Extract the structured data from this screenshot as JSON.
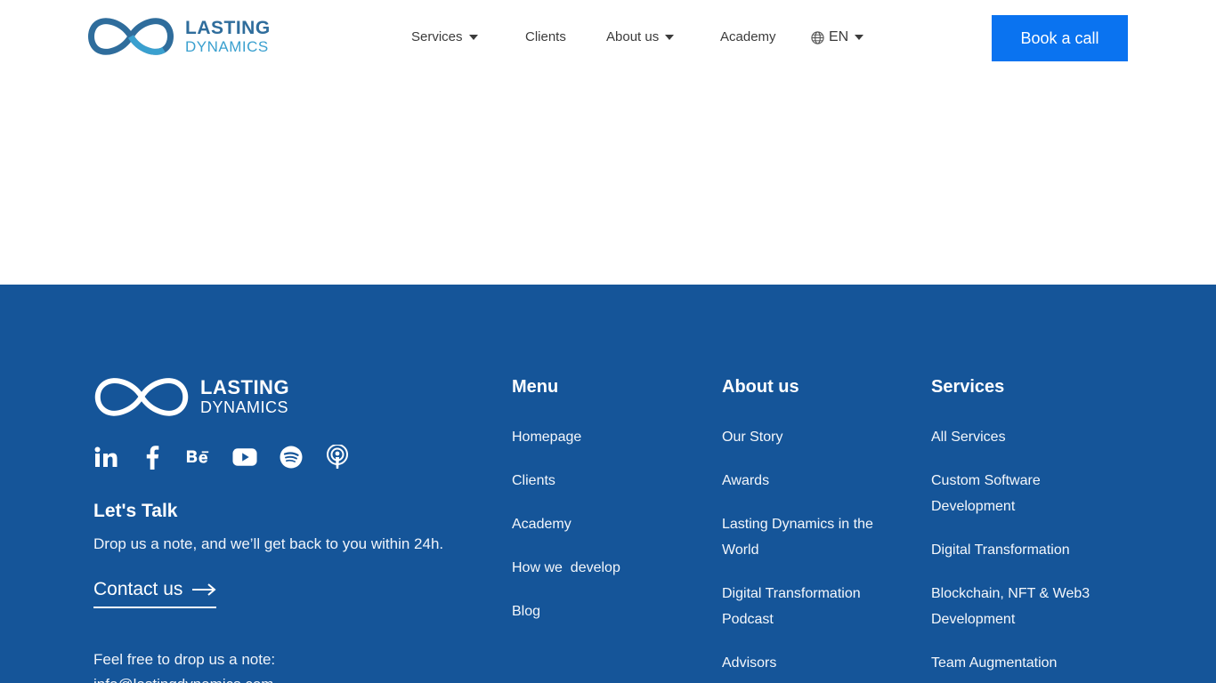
{
  "header": {
    "logo": {
      "line1": "LASTING",
      "line2": "DYNAMICS"
    },
    "nav": [
      {
        "label": "Services",
        "dropdown": true
      },
      {
        "label": "Clients",
        "dropdown": false
      },
      {
        "label": "About us",
        "dropdown": true
      },
      {
        "label": "Academy",
        "dropdown": false
      }
    ],
    "language": {
      "label": "EN",
      "icon": "globe-icon"
    },
    "cta_label": "Book a call",
    "cta_color": "#0a73f0"
  },
  "footer": {
    "bg_color": "#155599",
    "logo": {
      "line1": "LASTING",
      "line2": "DYNAMICS"
    },
    "socials": [
      "linkedin-icon",
      "facebook-icon",
      "behance-icon",
      "youtube-icon",
      "spotify-icon",
      "podcast-icon"
    ],
    "talk_title": "Let's Talk",
    "talk_sub": "Drop us a note, and we’ll get back to you within 24h.",
    "contact_label": "Contact us",
    "note_label": "Feel free to drop us a note:",
    "email": "info@lastingdynamics.com",
    "menu": {
      "title": "Menu",
      "items": [
        "Homepage",
        "Clients",
        "Academy",
        "How we  develop",
        "Blog"
      ]
    },
    "about": {
      "title": "About us",
      "items": [
        "Our Story",
        "Awards",
        "Lasting Dynamics in the World",
        "Digital Transformation Podcast",
        "Advisors"
      ]
    },
    "services": {
      "title": "Services",
      "items": [
        "All Services",
        "Custom Software Development",
        "Digital Transformation",
        "Blockchain, NFT & Web3 Development",
        "Team Augmentation"
      ]
    }
  }
}
